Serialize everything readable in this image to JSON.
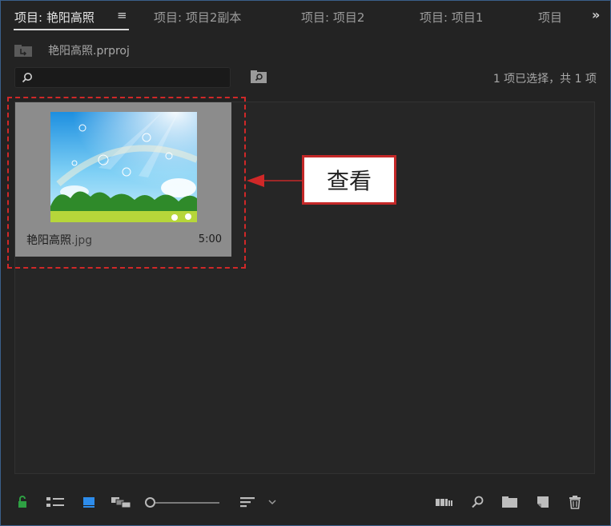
{
  "tabs": [
    {
      "label": "项目: 艳阳高照",
      "active": true
    },
    {
      "label": "项目: 项目2副本"
    },
    {
      "label": "项目: 项目2"
    },
    {
      "label": "项目: 项目1"
    },
    {
      "label": "项目"
    }
  ],
  "tab_menu_glyph": "≡",
  "overflow_glyph": "»",
  "project": {
    "name": "艳阳高照.prproj"
  },
  "selection_status": "1 项已选择，共 1 项",
  "clip": {
    "name": "艳阳高照",
    "ext": ".jpg",
    "duration": "5:00"
  },
  "callout": {
    "label": "查看"
  },
  "colors": {
    "accent_blue": "#2d8ceb",
    "lock_green": "#2ea043",
    "annotation_red": "#d02828"
  },
  "icons": {
    "lock": "lock-icon",
    "list_view": "list-view-icon",
    "icon_view": "icon-view-icon",
    "freeform_view": "freeform-view-icon",
    "sort": "sort-icon",
    "automate": "automate-to-sequence-icon",
    "find": "find-icon",
    "new_bin": "new-bin-icon",
    "new_item": "new-item-icon",
    "clear": "trash-icon"
  }
}
